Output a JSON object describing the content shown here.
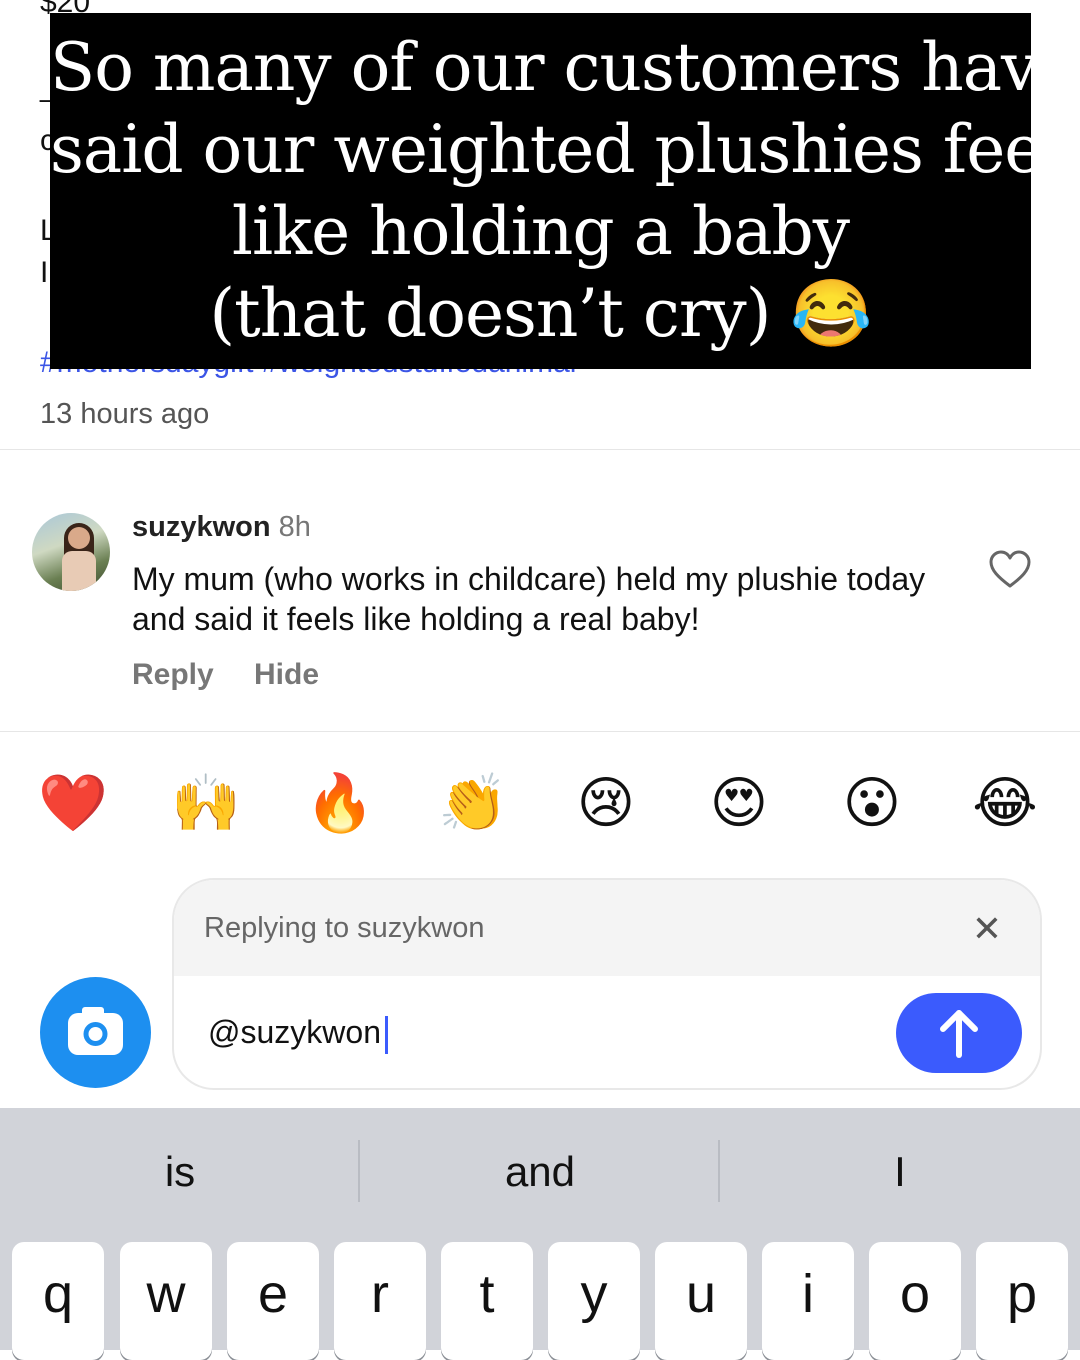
{
  "post": {
    "partial_price": "$20",
    "partial_fragments": [
      "L",
      "I",
      "c",
      "_"
    ],
    "hashtags_partial": "#mothersdaygift #weightedstuffedanimal",
    "time_ago": "13 hours ago"
  },
  "overlay": {
    "lines": [
      "So many of our customers have",
      "said our weighted plushies feels",
      "like holding a baby",
      "(that doesn’t cry) 😂"
    ]
  },
  "comment": {
    "username": "suzykwon",
    "age": "8h",
    "text": "My mum (who works in childcare) held my plushie today and said it feels like holding a real baby!",
    "reply_label": "Reply",
    "hide_label": "Hide"
  },
  "quick_reactions": [
    "❤️",
    "🙌",
    "🔥",
    "👏",
    "😢",
    "😍",
    "😮",
    "😂"
  ],
  "composer": {
    "replying_to": "Replying to suzykwon",
    "close_icon": "close-icon",
    "input_value": "@suzykwon",
    "send_icon": "arrow-up-icon",
    "camera_icon": "camera-icon"
  },
  "keyboard": {
    "suggestions": [
      "is",
      "and",
      "I"
    ],
    "row1": [
      "q",
      "w",
      "e",
      "r",
      "t",
      "y",
      "u",
      "i",
      "o",
      "p"
    ]
  },
  "colors": {
    "accent": "#3b5bfd",
    "camera": "#1d8ff0",
    "keyboard_bg": "#d1d3d9"
  }
}
